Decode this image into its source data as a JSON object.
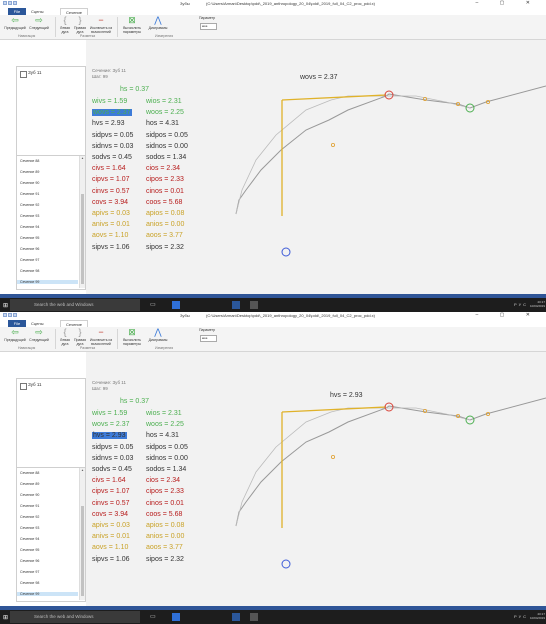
{
  "titlebar": {
    "app_name": "Зубы",
    "path": "(C:\\Users\\Arman\\Desktop\\pdd\\_2019_anthropology_20_04\\pdd\\_2019_full_04_C2_proc_pdd.x)",
    "controls": "–  ▢  ✕"
  },
  "tabs": {
    "file": "File",
    "t1": "Сцены",
    "t2": "Сечение"
  },
  "ribbon": {
    "buttons": [
      "Предыдущий",
      "Следующий",
      "Левая дуга",
      "Правая дуга",
      "Исключить из вычислений",
      "Вычислить параметры",
      "Диаграммы",
      "Параметр"
    ],
    "groups": [
      "Навигация",
      "Разметка",
      "Измерения"
    ],
    "combo_value": "wos"
  },
  "leftpane": {
    "top_item": "Зуб 11",
    "items": [
      "Сечение 88",
      "Сечение 89",
      "Сечение 90",
      "Сечение 91",
      "Сечение 92",
      "Сечение 93",
      "Сечение 94",
      "Сечение 95",
      "Сечение 96",
      "Сечение 97",
      "Сечение 98",
      "Сечение 99"
    ]
  },
  "panel": {
    "header": "Сечение: Зуб 11",
    "step": "Шаг: 99",
    "hs": "hs = 0.37",
    "measures": [
      {
        "l": "wivs = 1.59",
        "r": "wios = 2.31",
        "color": "#4caf50"
      },
      {
        "l": "wovs = 2.37",
        "r": "woos = 2.25",
        "color": "#4caf50"
      },
      {
        "l": "hvs = 2.93",
        "r": "hos = 4.31",
        "color": "#333333"
      },
      {
        "l": "sidpvs = 0.05",
        "r": "sidpos = 0.05",
        "color": "#333333"
      },
      {
        "l": "sidnvs = 0.03",
        "r": "sidnos = 0.00",
        "color": "#333333"
      },
      {
        "l": "sodvs = 0.45",
        "r": "sodos = 1.34",
        "color": "#333333"
      },
      {
        "l": "civs = 1.64",
        "r": "cios = 2.34",
        "color": "#b71c1c"
      },
      {
        "l": "cipvs = 1.07",
        "r": "cipos = 2.33",
        "color": "#b71c1c"
      },
      {
        "l": "cinvs = 0.57",
        "r": "cinos = 0.01",
        "color": "#b71c1c"
      },
      {
        "l": "covs = 3.94",
        "r": "coos = 5.68",
        "color": "#b71c1c"
      },
      {
        "l": "apivs = 0.03",
        "r": "apios = 0.08",
        "color": "#c9a227"
      },
      {
        "l": "anivs = 0.01",
        "r": "anios = 0.00",
        "color": "#c9a227"
      },
      {
        "l": "aovs = 1.10",
        "r": "aoos = 3.77",
        "color": "#c9a227"
      },
      {
        "l": "sipvs = 1.06",
        "r": "sipos = 2.32",
        "color": "#333333"
      }
    ]
  },
  "shots": [
    {
      "overlay": "wovs = 2.37",
      "highlight_index": 1
    },
    {
      "overlay": "hvs = 2.93",
      "highlight_index": 2
    }
  ],
  "taskbar": {
    "search": "Search the web and Windows",
    "lang": "РУС",
    "time": "20:17",
    "date": "10/04/2019"
  }
}
